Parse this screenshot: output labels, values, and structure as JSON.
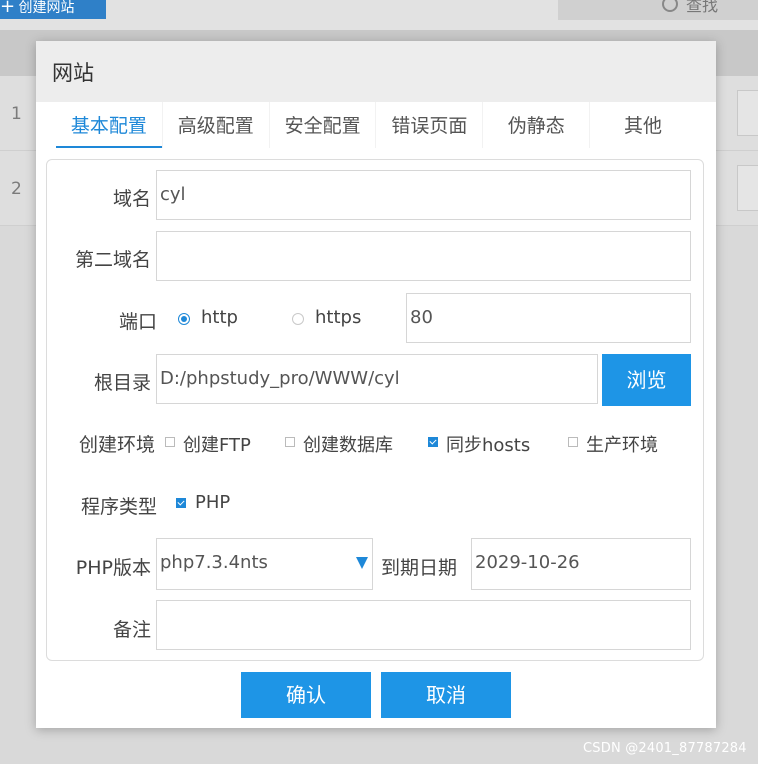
{
  "background": {
    "create_site_label": "创建网站",
    "search_label": "查找",
    "rows": [
      "1",
      "2"
    ]
  },
  "dialog": {
    "title": "网站",
    "tabs": [
      "基本配置",
      "高级配置",
      "安全配置",
      "错误页面",
      "伪静态",
      "其他"
    ],
    "active_tab": "基本配置",
    "form": {
      "domain_label": "域名",
      "domain_value": "cyl",
      "second_domain_label": "第二域名",
      "second_domain_value": "",
      "port_label": "端口",
      "protocol_http": "http",
      "protocol_https": "https",
      "protocol_selected": "http",
      "port_value": "80",
      "root_label": "根目录",
      "root_value": "D:/phpstudy_pro/WWW/cyl",
      "browse_button": "浏览",
      "env_label": "创建环境",
      "env_options": [
        {
          "label": "创建FTP",
          "checked": false
        },
        {
          "label": "创建数据库",
          "checked": false
        },
        {
          "label": "同步hosts",
          "checked": true
        },
        {
          "label": "生产环境",
          "checked": false
        }
      ],
      "program_type_label": "程序类型",
      "program_type_option": "PHP",
      "program_type_checked": true,
      "php_version_label": "PHP版本",
      "php_version_value": "php7.3.4nts",
      "expiry_label": "到期日期",
      "expiry_value": "2029-10-26",
      "remark_label": "备注",
      "remark_value": ""
    },
    "confirm_button": "确认",
    "cancel_button": "取消"
  },
  "watermark": "CSDN @2401_87787284",
  "colors": {
    "accent": "#1e88d8",
    "button": "#1e95e6",
    "title_bar": "#ededed"
  }
}
